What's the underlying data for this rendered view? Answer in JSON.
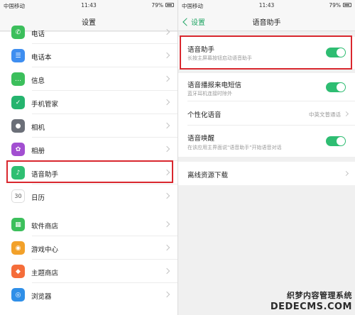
{
  "status": {
    "carrier": "中国移动",
    "time": "11:43",
    "battery": "79%"
  },
  "left": {
    "title": "设置",
    "items": [
      {
        "label": "电话",
        "icon": "phone-icon",
        "color": "#3cbf5c",
        "glyph": "✆"
      },
      {
        "label": "电话本",
        "icon": "contacts-icon",
        "color": "#3e8ef0",
        "glyph": "☰"
      },
      {
        "label": "信息",
        "icon": "message-icon",
        "color": "#3cbf5c",
        "glyph": "…"
      },
      {
        "label": "手机管家",
        "icon": "security-icon",
        "color": "#25b46e",
        "glyph": "✓"
      },
      {
        "label": "相机",
        "icon": "camera-icon",
        "color": "#6b6f78",
        "glyph": "●"
      },
      {
        "label": "相册",
        "icon": "album-icon",
        "color": "#a24fd1",
        "glyph": "✿"
      },
      {
        "label": "语音助手",
        "icon": "microphone-icon",
        "color": "#2fbf72",
        "glyph": "♪"
      },
      {
        "label": "日历",
        "icon": "calendar-icon",
        "color": "#ffffff",
        "glyph": "30"
      },
      {
        "label": "软件商店",
        "icon": "app-store-icon",
        "color": "#3cbf5c",
        "glyph": "▦"
      },
      {
        "label": "游戏中心",
        "icon": "game-center-icon",
        "color": "#f2a12a",
        "glyph": "◉"
      },
      {
        "label": "主题商店",
        "icon": "theme-store-icon",
        "color": "#f56d3a",
        "glyph": "◆"
      },
      {
        "label": "浏览器",
        "icon": "browser-icon",
        "color": "#2f8fe8",
        "glyph": "◎"
      }
    ]
  },
  "right": {
    "back_label": "设置",
    "title": "语音助手",
    "assistant": {
      "title": "语音助手",
      "subtitle": "长按主屏幕按钮启动语音助手"
    },
    "broadcast": {
      "title": "语音播报来电短信",
      "subtitle": "蓝牙耳机连接时除外"
    },
    "personal_voice": {
      "title": "个性化语音",
      "value": "中英文普通话"
    },
    "wake": {
      "title": "语音唤醒",
      "subtitle": "在该应用主界面说\"语音助手\"开始语音对话"
    },
    "offline": {
      "title": "离线资源下载"
    }
  },
  "watermark": {
    "line1": "织梦内容管理系统",
    "line2": "DEDECMS.COM"
  }
}
